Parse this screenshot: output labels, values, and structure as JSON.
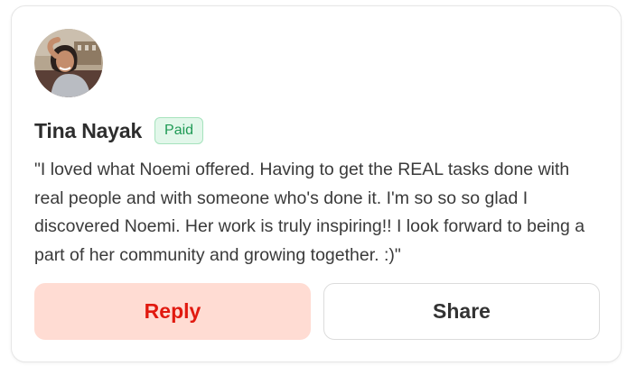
{
  "review": {
    "name": "Tina Nayak",
    "badge": "Paid",
    "text": "\"I loved what Noemi offered. Having to get the REAL tasks done with real people and with someone who's done it. I'm so so so glad I discovered Noemi. Her work is truly inspiring!! I look forward to being a part of her community and growing together. :)\""
  },
  "actions": {
    "reply_label": "Reply",
    "share_label": "Share"
  },
  "colors": {
    "reply_bg": "#ffdcd3",
    "reply_text": "#e1190f",
    "badge_bg": "#e2f7ea",
    "badge_text": "#1f9a55"
  }
}
